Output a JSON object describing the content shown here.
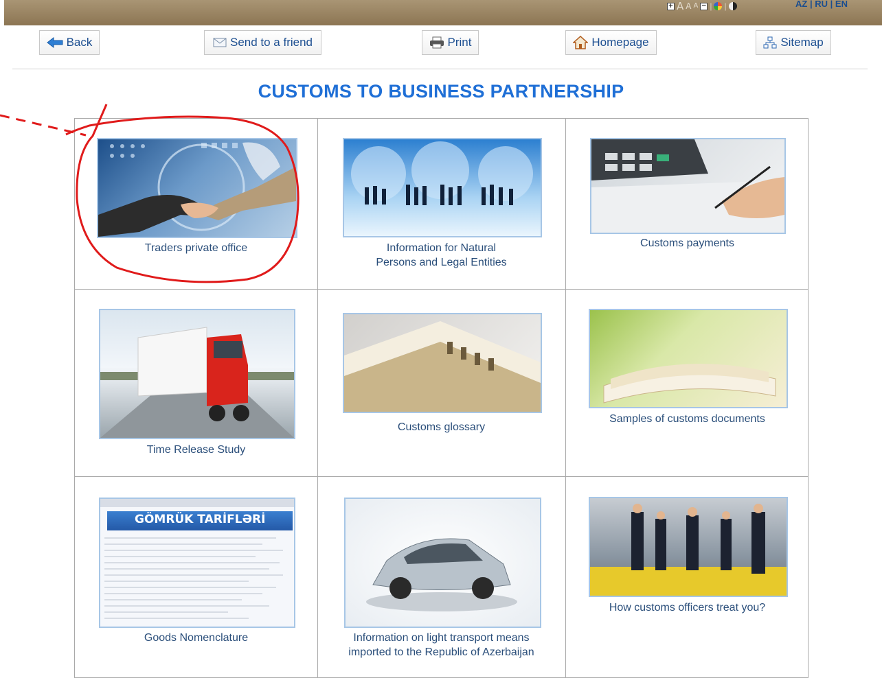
{
  "header": {
    "accessibility": {
      "font_letters": [
        "A",
        "A",
        "A"
      ]
    },
    "languages": [
      "AZ",
      "RU",
      "EN"
    ],
    "language_separator": "|"
  },
  "toolbar": {
    "back": "Back",
    "send": "Send to a friend",
    "print": "Print",
    "homepage": "Homepage",
    "sitemap": "Sitemap"
  },
  "page_title": "CUSTOMS TO BUSINESS PARTNERSHIP",
  "tiles": [
    {
      "caption": "Traders private office",
      "image": "handshake-image"
    },
    {
      "caption_lines": [
        "Information for Natural",
        "Persons and Legal Entities"
      ],
      "image": "globe-network-image"
    },
    {
      "caption": "Customs payments",
      "image": "calculator-image"
    },
    {
      "caption": "Time Release Study",
      "image": "truck-image"
    },
    {
      "caption": "Customs glossary",
      "image": "book-image"
    },
    {
      "caption": "Samples of customs documents",
      "image": "documents-image"
    },
    {
      "caption": "Goods Nomenclature",
      "image": "gomruk-tarifleri-image",
      "image_text": "GÖMRÜK TARİFLƏRİ"
    },
    {
      "caption_lines": [
        "Information on light transport means",
        "imported to the Republic of Azerbaijan"
      ],
      "image": "car-image"
    },
    {
      "caption": "How customs officers treat you?",
      "image": "officers-image"
    }
  ],
  "colors": {
    "topbar": "#9e8a66",
    "title": "#1f6fd6",
    "link": "#1d4f91",
    "caption": "#2a4e7a",
    "annotation": "#e01b1b",
    "thumb_border": "#a7c6e6"
  }
}
